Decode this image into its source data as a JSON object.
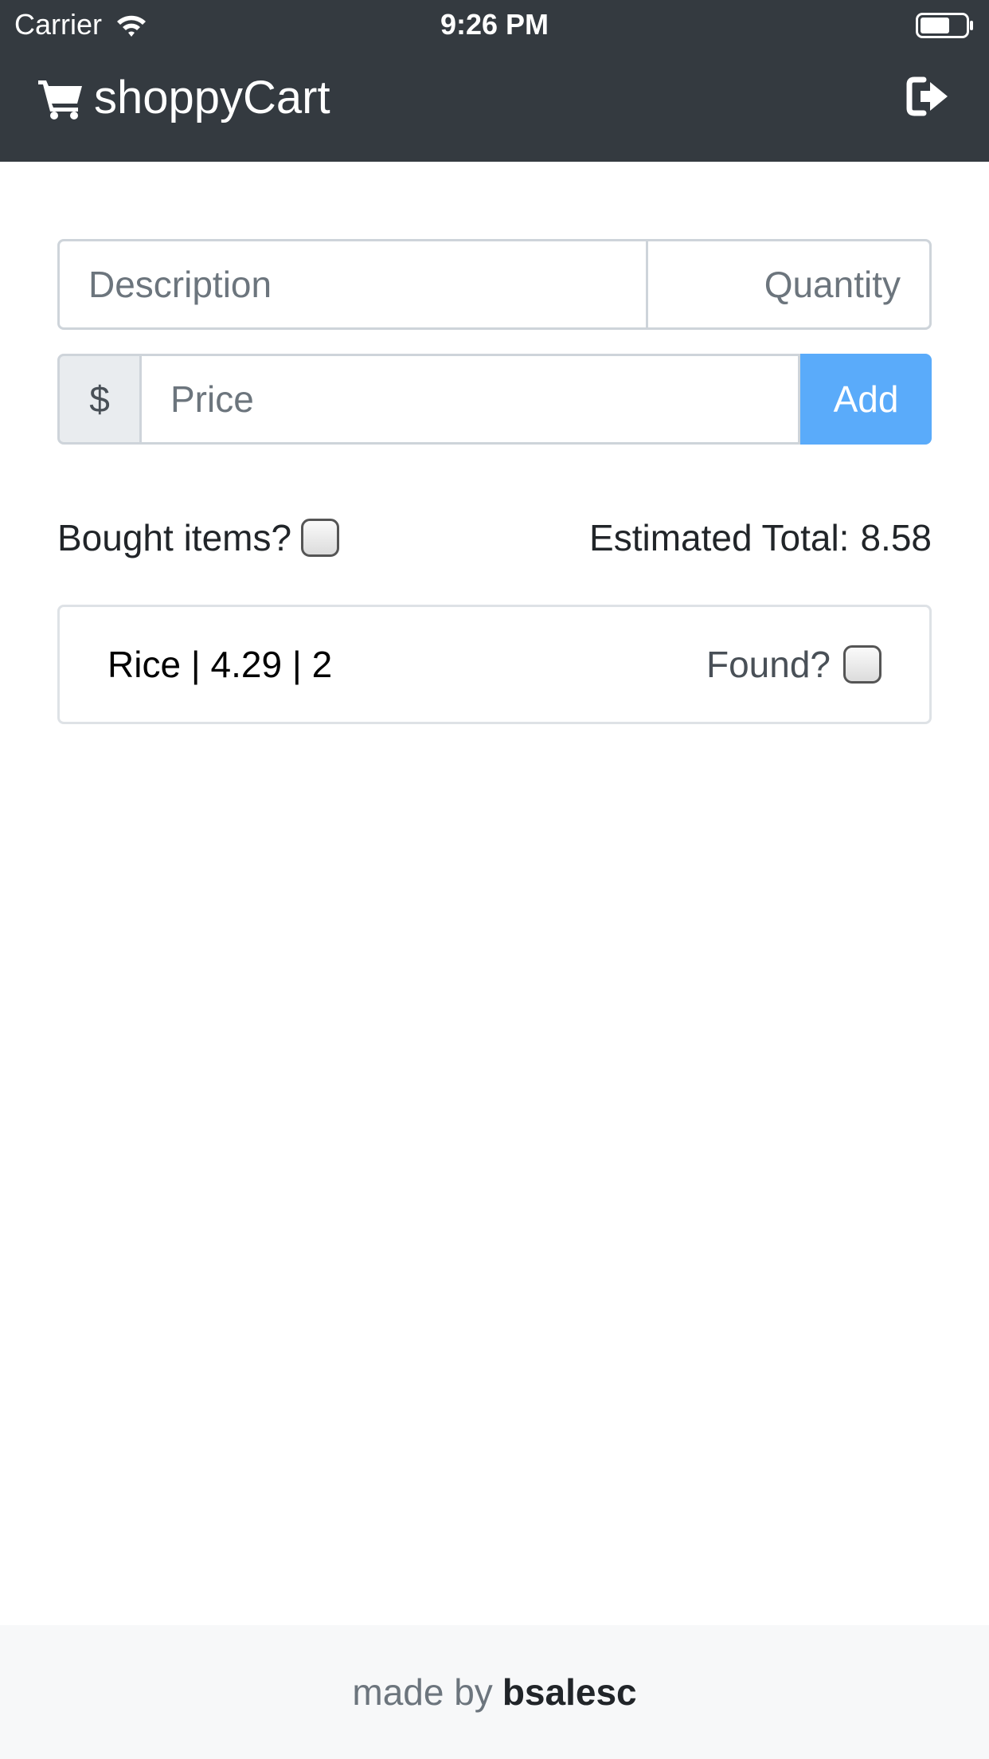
{
  "status_bar": {
    "carrier": "Carrier",
    "time": "9:26 PM",
    "icons": [
      "wifi-icon",
      "battery-icon"
    ]
  },
  "navbar": {
    "brand": "shoppyCart",
    "brand_icon": "cart-icon",
    "logout_icon": "sign-out-icon",
    "background_color": "#343a40"
  },
  "form": {
    "description_placeholder": "Description",
    "quantity_placeholder": "Quantity",
    "currency_symbol": "$",
    "price_placeholder": "Price",
    "add_label": "Add",
    "add_button_color": "#5aabfa"
  },
  "options": {
    "bought_label": "Bought items?",
    "bought_checked": false,
    "total_label": "Estimated Total:",
    "total_value": "8.58"
  },
  "items": [
    {
      "text": "Rice | 4.29 | 2",
      "found_label": "Found?",
      "found_checked": false
    }
  ],
  "footer": {
    "made_by": "made by",
    "author": "bsalesc"
  }
}
